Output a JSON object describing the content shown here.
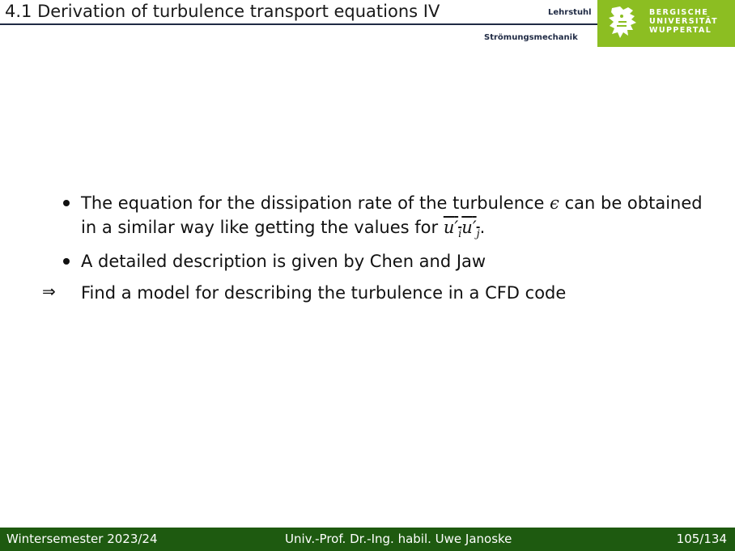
{
  "header": {
    "title": "4.1 Derivation of turbulence transport equations IV",
    "chair_line1": "Lehrstuhl",
    "chair_line2": "Strömungsmechanik",
    "logo_lines": [
      "BERGISCHE",
      "UNIVERSITÄT",
      "WUPPERTAL"
    ]
  },
  "body": {
    "bullet1_part1": "The equation for the dissipation rate of the turbulence",
    "bullet1_symbol": "ϵ",
    "bullet1_part2": "can be obtained",
    "bullet1_line2_text": "in a similar way like getting the values for",
    "bullet1_math_u": "u",
    "bullet1_math_prime": "′",
    "bullet1_math_i": "i",
    "bullet1_math_j": "j",
    "bullet1_end": ".",
    "bullet2": "A detailed description is given by Chen and Jaw",
    "conclusion_arrow": "⇒",
    "conclusion": "Find a model for describing the turbulence in a CFD code"
  },
  "footer": {
    "term": "Wintersemester 2023/24",
    "author": "Univ.-Prof. Dr.-Ing. habil. Uwe Janoske",
    "page": "105/134"
  },
  "colors": {
    "accent_green": "#8cbe22",
    "footer_green": "#1e5a10",
    "rule": "#1f2a44"
  }
}
